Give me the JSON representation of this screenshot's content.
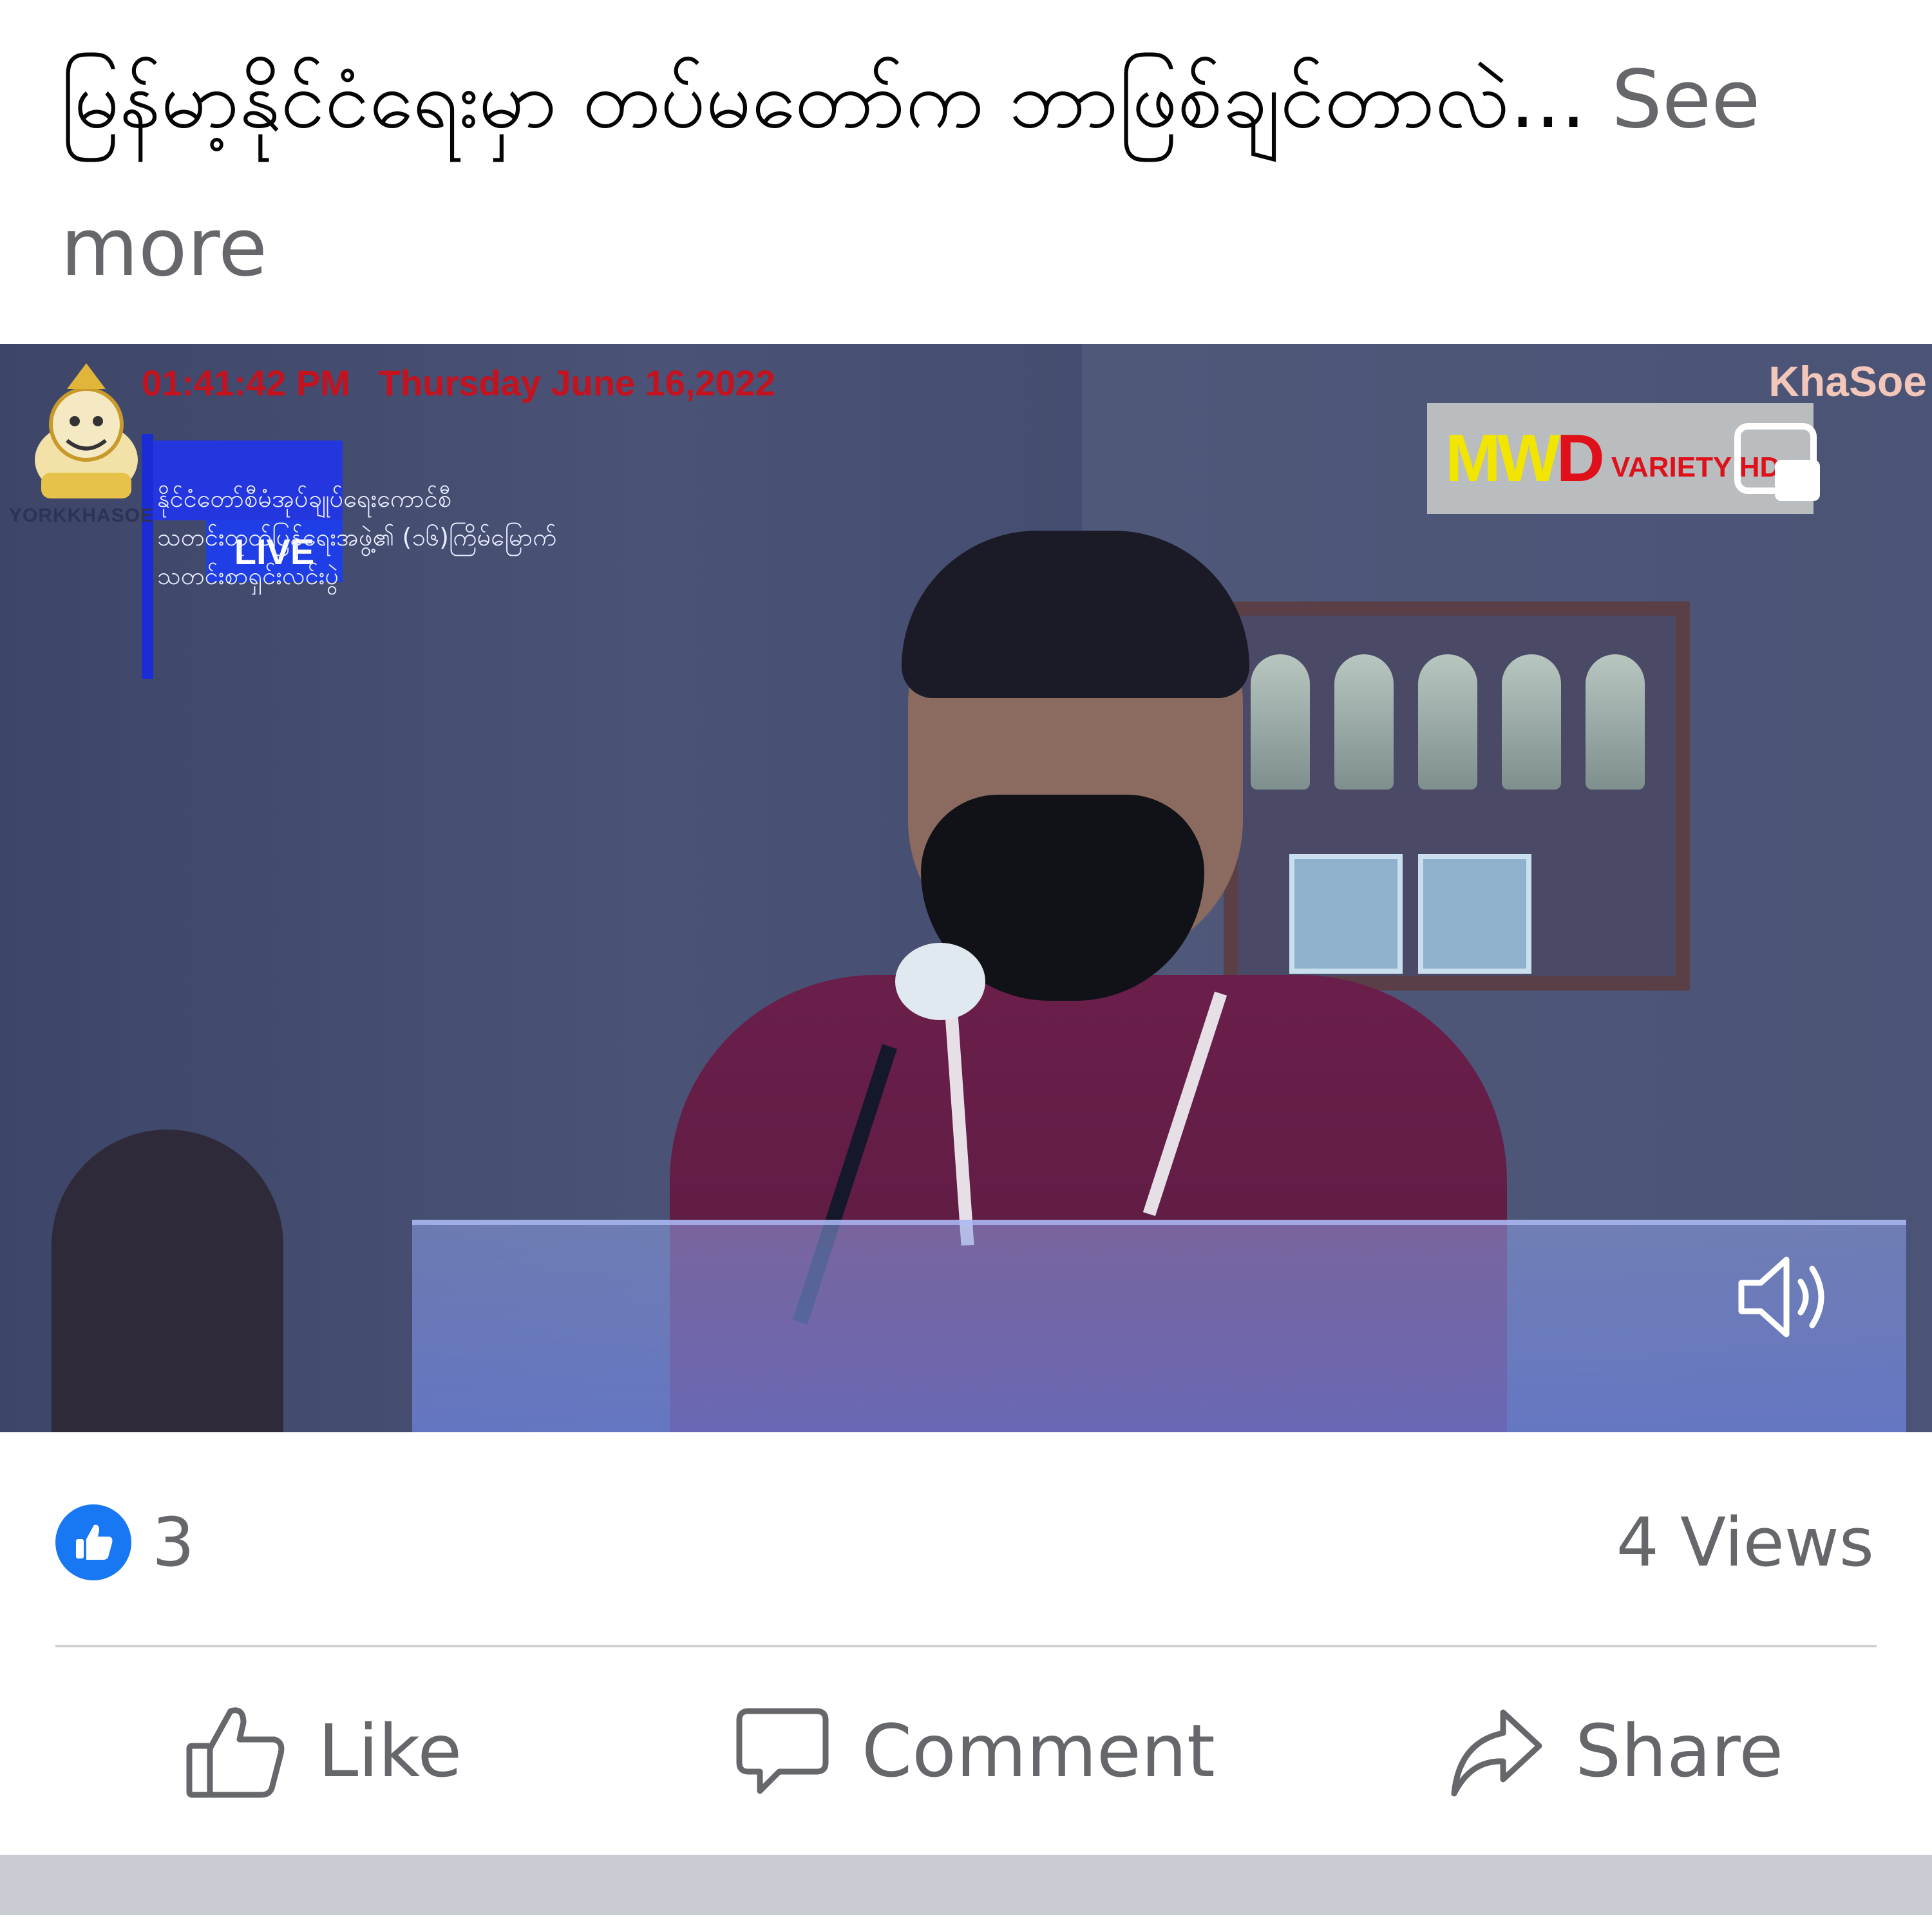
{
  "post": {
    "caption_text": "မြန်မာ့နိုင်ငံရေးမှာ တပ်မတော်က ဘာဖြစ်ချင်တာလဲ... ",
    "see_more_label": "See more"
  },
  "video": {
    "timestamp": "01:41:42 PM",
    "date": "Thursday June 16,2022",
    "live_label": "LIVE",
    "logo_caption": "YORKKHASOE",
    "event_lines": [
      "နိုင်ငံတော်စီမံအုပ်ချုပ်ရေးကောင်စီ",
      "သတင်းထုတ်ပြန်ရေးအဖွဲ့၏ (၁၆)ကြိမ်မြောက်",
      "သတင်းစာရှင်းလင်းပွဲ"
    ],
    "top_right_brand": "KhaSoe",
    "mwd_badge": {
      "mw": "MW",
      "d": "D",
      "variety": "VARIETY HD"
    },
    "icons": {
      "fullscreen": "fullscreen-icon",
      "volume": "volume-icon",
      "mascot": "mascot-logo"
    }
  },
  "stats": {
    "reaction_count": "3",
    "views_label": "4 Views"
  },
  "actions": {
    "like_label": "Like",
    "comment_label": "Comment",
    "share_label": "Share"
  },
  "colors": {
    "facebook_blue": "#1877f2",
    "secondary_text": "#65676b",
    "timestamp_red": "#c4121e",
    "live_blue": "#1f3ee6"
  }
}
